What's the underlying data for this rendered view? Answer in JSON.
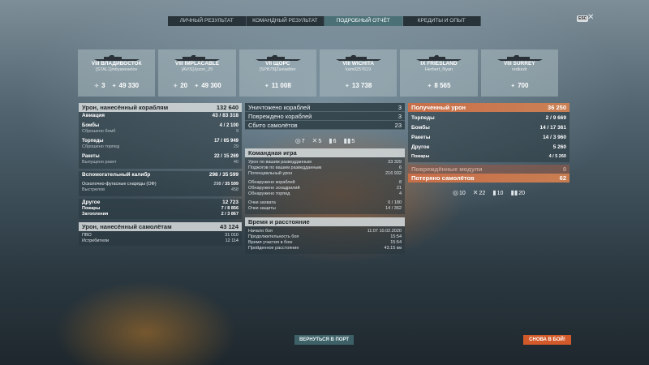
{
  "tabs": [
    {
      "label": "ЛИЧНЫЙ РЕЗУЛЬТАТ",
      "active": false
    },
    {
      "label": "КОМАНДНЫЙ РЕЗУЛЬТАТ",
      "active": false
    },
    {
      "label": "ПОДРОБНЫЙ ОТЧЁТ",
      "active": true
    },
    {
      "label": "КРЕДИТЫ И ОПЫТ",
      "active": false
    }
  ],
  "esc_label": "ESC",
  "close_glyph": "✕",
  "ships": [
    {
      "name": "VIII ВЛАДИВОСТОК",
      "player": "[STAL1]mityaveselov",
      "kills": "3",
      "damage": "49 330"
    },
    {
      "name": "VIII IMPLACABLE",
      "player": "[AVIS]Jyzon_25",
      "kills": "20",
      "damage": "49 300"
    },
    {
      "name": "VII ЩОРС",
      "player": "[SPB78]Zaviadder",
      "kills": "",
      "damage": "11 008"
    },
    {
      "name": "VIII WICHITA",
      "player": "kamil257619",
      "kills": "",
      "damage": "13 738"
    },
    {
      "name": "IX FRIESLAND",
      "player": "Herbert_Nyan",
      "kills": "",
      "damage": "8 565"
    },
    {
      "name": "VIII SURREY",
      "player": "redkedr",
      "kills": "",
      "damage": "700"
    }
  ],
  "left": {
    "damage_header": {
      "label": "Урон, нанесённый кораблям",
      "value": "132 640"
    },
    "aviation": {
      "label": "Авиация",
      "value_a": "43 /",
      "value_b": "83 318"
    },
    "bombs": {
      "label": "Бомбы",
      "value_a": "4 /",
      "value_b": "2 100"
    },
    "bombs_dropped": {
      "label": "Сброшено бомб",
      "value": "9"
    },
    "torpedoes": {
      "label": "Торпеды",
      "value_a": "17 /",
      "value_b": "65 949"
    },
    "torps_dropped": {
      "label": "Сброшено торпед",
      "value": "29"
    },
    "rockets": {
      "label": "Ракеты",
      "value_a": "22 /",
      "value_b": "15 269"
    },
    "rockets_fired": {
      "label": "Выпущено ракет",
      "value": "40"
    },
    "main_battery": {
      "label": "Вспомогательный калибр",
      "value_a": "298 /",
      "value_b": "35 599"
    },
    "he_shells": {
      "label": "Осколочно-фугасные снаряды (ОФ)",
      "value_a": "298 /",
      "value_b": "35 599"
    },
    "shots": {
      "label": "Выстрелов",
      "value": "458"
    },
    "other": {
      "label": "Другое",
      "value": "12 723"
    },
    "fires": {
      "label": "Пожары",
      "value_a": "7 /",
      "value_b": "8 856"
    },
    "floods": {
      "label": "Затопления",
      "value_a": "2 /",
      "value_b": "3 867"
    },
    "plane_header": {
      "label": "Урон, нанесённый самолётам",
      "value": "43 124"
    },
    "aa": {
      "label": "ПВО",
      "value": "31 010"
    },
    "fighters": {
      "label": "Истребители",
      "value": "12 114"
    }
  },
  "middle": {
    "destroyed": {
      "label": "Уничтожено кораблей",
      "value": "3"
    },
    "damaged": {
      "label": "Повреждено кораблей",
      "value": "3"
    },
    "planes": {
      "label": "Сбито самолётов",
      "value": "23"
    },
    "icons": [
      {
        "glyph": "◎",
        "value": "7"
      },
      {
        "glyph": "✕",
        "value": "5"
      },
      {
        "glyph": "▮",
        "value": "6"
      },
      {
        "glyph": "▮▮",
        "value": "5"
      }
    ],
    "team_header": "Командная игра",
    "team_rows": [
      {
        "label": "Урон по вашим разведданным",
        "value": "33 329"
      },
      {
        "label": "Поджогов по вашим разведданным",
        "value": "6"
      },
      {
        "label": "Потенциальный урон",
        "value": "216 932"
      },
      {
        "label": "",
        "value": ""
      },
      {
        "label": "Обнаружено кораблей",
        "value": "8"
      },
      {
        "label": "Обнаружено эскадрилий",
        "value": "21"
      },
      {
        "label": "Обнаружено торпед",
        "value": "4"
      },
      {
        "label": "",
        "value": ""
      },
      {
        "label": "Очки захвата",
        "value": "0 / 180"
      },
      {
        "label": "Очки защиты",
        "value": "14 / 362"
      }
    ],
    "time_header": "Время и расстояние",
    "time_rows": [
      {
        "label": "Начало боя",
        "value": "11:07  10.02.2020"
      },
      {
        "label": "Продолжительность боя",
        "value": "15:54"
      },
      {
        "label": "Время участия в бою",
        "value": "15:54"
      },
      {
        "label": "Пройденное расстояние",
        "value": "43.15 км"
      }
    ]
  },
  "right": {
    "received": {
      "label": "Полученный урон",
      "value": "36 250"
    },
    "torpedoes": {
      "label": "Торпеды",
      "value_a": "2 /",
      "value_b": "9 669"
    },
    "bombs": {
      "label": "Бомбы",
      "value_a": "14 /",
      "value_b": "17 361"
    },
    "rockets": {
      "label": "Ракеты",
      "value_a": "14 /",
      "value_b": "3 960"
    },
    "other": {
      "label": "Другое",
      "value": "5 260"
    },
    "fires": {
      "label": "Пожары",
      "value": "4 / 5 260"
    },
    "modules": {
      "label": "Повреждённые модули",
      "value": "0"
    },
    "planes_lost": {
      "label": "Потеряно самолётов",
      "value": "62"
    },
    "icons": [
      {
        "glyph": "◎",
        "value": "10"
      },
      {
        "glyph": "✕",
        "value": "22"
      },
      {
        "glyph": "▮",
        "value": "10"
      },
      {
        "glyph": "▮▮",
        "value": "20"
      }
    ]
  },
  "buttons": {
    "port": "ВЕРНУТЬСЯ В ПОРТ",
    "battle": "СНОВА В БОЙ!"
  }
}
